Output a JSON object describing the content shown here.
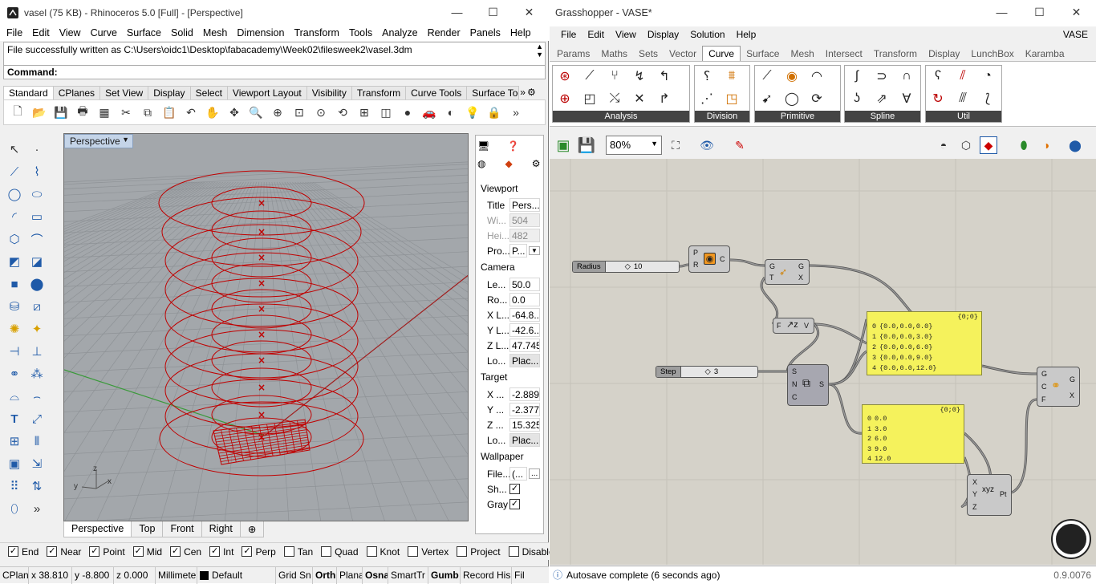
{
  "rhino": {
    "title": "vasel (75 KB) - Rhinoceros 5.0 [Full] - [Perspective]",
    "menu": [
      "File",
      "Edit",
      "View",
      "Curve",
      "Surface",
      "Solid",
      "Mesh",
      "Dimension",
      "Transform",
      "Tools",
      "Analyze",
      "Render",
      "Panels",
      "Help"
    ],
    "command_history": "File successfully written as C:\\Users\\oidc1\\Desktop\\fabacademy\\Week02\\filesweek2\\vasel.3dm",
    "command_label": "Command:",
    "toolbar_tabs": [
      "Standard",
      "CPlanes",
      "Set View",
      "Display",
      "Select",
      "Viewport Layout",
      "Visibility",
      "Transform",
      "Curve Tools",
      "Surface Too"
    ],
    "viewport_title": "Perspective",
    "viewport_tabs": [
      "Perspective",
      "Top",
      "Front",
      "Right"
    ],
    "axis_labels": {
      "x": "x",
      "y": "y",
      "z": "z"
    },
    "properties": {
      "viewport_header": "Viewport",
      "title_label": "Title",
      "title_value": "Pers...",
      "width_label": "Wi...",
      "width_value": "504",
      "height_label": "Hei...",
      "height_value": "482",
      "projection_label": "Pro...",
      "projection_value": "P...",
      "camera_header": "Camera",
      "lens_label": "Le...",
      "lens_value": "50.0",
      "rotation_label": "Ro...",
      "rotation_value": "0.0",
      "xloc_label": "X L...",
      "xloc_value": "-64.8...",
      "yloc_label": "Y L...",
      "yloc_value": "-42.6...",
      "zloc_label": "Z L...",
      "zloc_value": "47.745",
      "loc_label": "Lo...",
      "loc_button": "Plac...",
      "target_header": "Target",
      "tx_label": "X ...",
      "tx_value": "-2.889",
      "ty_label": "Y ...",
      "ty_value": "-2.377",
      "tz_label": "Z ...",
      "tz_value": "15.325",
      "tloc_label": "Lo...",
      "tloc_button": "Plac...",
      "wallpaper_header": "Wallpaper",
      "file_label": "File...",
      "file_value": "(...",
      "file_button": "...",
      "show_label": "Sh...",
      "gray_label": "Gray"
    },
    "osnaps": [
      {
        "label": "End",
        "checked": true
      },
      {
        "label": "Near",
        "checked": true
      },
      {
        "label": "Point",
        "checked": true
      },
      {
        "label": "Mid",
        "checked": true
      },
      {
        "label": "Cen",
        "checked": true
      },
      {
        "label": "Int",
        "checked": true
      },
      {
        "label": "Perp",
        "checked": true
      },
      {
        "label": "Tan",
        "checked": false
      },
      {
        "label": "Quad",
        "checked": false
      },
      {
        "label": "Knot",
        "checked": false
      },
      {
        "label": "Vertex",
        "checked": false
      },
      {
        "label": "Project",
        "checked": false
      },
      {
        "label": "Disable",
        "checked": false
      }
    ],
    "status": {
      "cplane": "CPlan",
      "x": "x 38.810",
      "y": "y -8.800",
      "z": "z 0.000",
      "units": "Millimete",
      "layer": "Default",
      "grid_snap": "Grid Sn",
      "ortho": "Orth",
      "planar": "Plana",
      "osnap": "Osna",
      "smarttrack": "SmartTr",
      "gumball": "Gumb",
      "record_history": "Record His",
      "filter": "Fil"
    }
  },
  "gh": {
    "title": "Grasshopper - VASE*",
    "menu": [
      "File",
      "Edit",
      "View",
      "Display",
      "Solution",
      "Help"
    ],
    "menu_right": "VASE",
    "tabs": [
      "Params",
      "Maths",
      "Sets",
      "Vector",
      "Curve",
      "Surface",
      "Mesh",
      "Intersect",
      "Transform",
      "Display",
      "LunchBox",
      "Karamba"
    ],
    "active_tab": "Curve",
    "ribbon_groups": [
      "Analysis",
      "Division",
      "Primitive",
      "Spline",
      "Util"
    ],
    "zoom": "80%",
    "canvas": {
      "radius_label": "Radius",
      "radius_value": "10",
      "step_label": "Step",
      "step_value": "3",
      "circle_inputs": [
        "P",
        "R"
      ],
      "circle_output": "C",
      "move_inputs": [
        "G",
        "T"
      ],
      "move_outputs": [
        "G",
        "X"
      ],
      "fz_input": "F",
      "fz_output": "V",
      "series_inputs": [
        "S",
        "N",
        "C"
      ],
      "series_output": "S",
      "loft_inputs": [
        "G",
        "C",
        "F"
      ],
      "loft_outputs": [
        "G",
        "X"
      ],
      "pt_inputs": [
        "X",
        "Y",
        "Z"
      ],
      "pt_output": "Pt",
      "panel1_header": "{0;0}",
      "panel1_rows": [
        {
          "i": "0",
          "v": "{0.0,0.0,0.0}"
        },
        {
          "i": "1",
          "v": "{0.0,0.0,3.0}"
        },
        {
          "i": "2",
          "v": "{0.0,0.0,6.0}"
        },
        {
          "i": "3",
          "v": "{0.0,0.0,9.0}"
        },
        {
          "i": "4",
          "v": "{0.0,0.0,12.0}"
        }
      ],
      "panel2_header": "{0;0}",
      "panel2_rows": [
        {
          "i": "0",
          "v": "0.0"
        },
        {
          "i": "1",
          "v": "3.0"
        },
        {
          "i": "2",
          "v": "6.0"
        },
        {
          "i": "3",
          "v": "9.0"
        },
        {
          "i": "4",
          "v": "12.0"
        }
      ]
    },
    "status": "Autosave complete (6 seconds ago)",
    "version": "0.9.0076"
  },
  "colors": {
    "curve": "#c00000",
    "panel": "#f5f25c",
    "viewport_bg": "#a3a7ab",
    "canvas_bg": "#d5d2c9"
  }
}
